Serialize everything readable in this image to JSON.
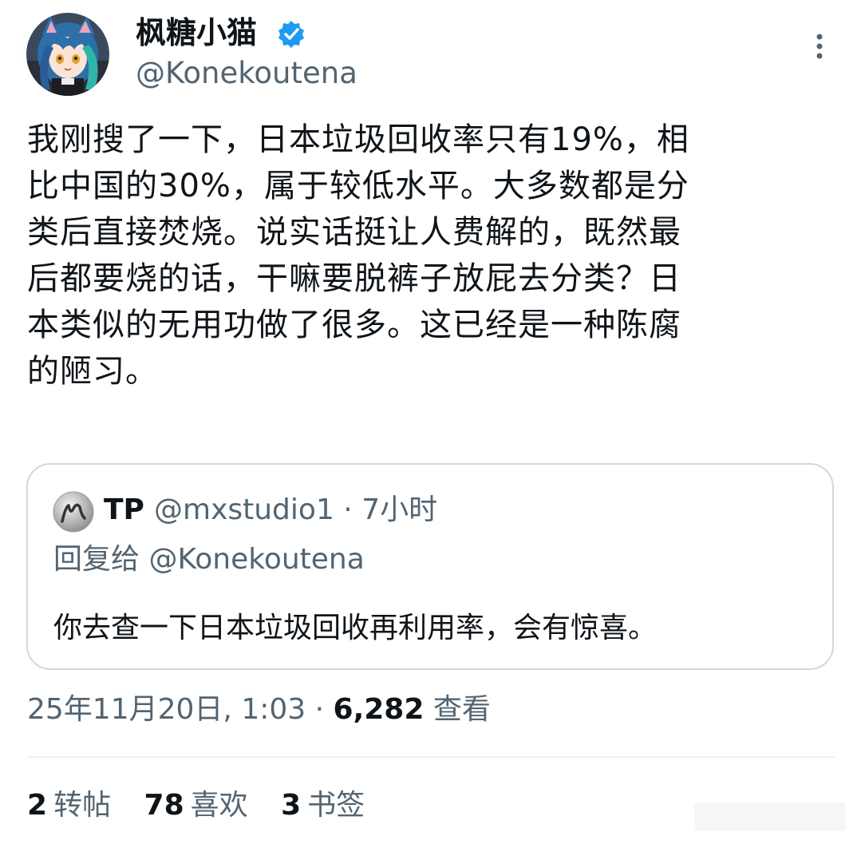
{
  "author": {
    "display_name": "枫糖小猫",
    "handle": "@Konekoutena",
    "avatar_icon": "anime-catgirl-avatar",
    "verified_icon": "verified-badge-icon",
    "verified_color": "#1d9bf0"
  },
  "tweet": {
    "text": "我刚搜了一下，日本垃圾回收率只有19%，相\n比中国的30%，属于较低水平。大多数都是分\n类后直接焚烧。说实话挺让人费解的，既然最\n后都要烧的话，干嘛要脱裤子放屁去分类？日\n本类似的无用功做了很多。这已经是一种陈腐\n的陋习。"
  },
  "quote": {
    "name": "TP",
    "handle": "@mxstudio1",
    "separator": "·",
    "time": "7小时",
    "reply_to": "回复给 @Konekoutena",
    "text": "你去查一下日本垃圾回收再利用率，会有惊喜。"
  },
  "meta": {
    "timestamp": "25年11月20日, 1:03",
    "separator": "·",
    "views_count": "6,282",
    "views_label": "查看"
  },
  "stats": {
    "retweets_count": "2",
    "retweets_label": "转帖",
    "likes_count": "78",
    "likes_label": "喜欢",
    "bookmarks_count": "3",
    "bookmarks_label": "书签"
  },
  "colors": {
    "text_primary": "#0f1419",
    "text_secondary": "#536471",
    "border": "#cfd9de"
  }
}
